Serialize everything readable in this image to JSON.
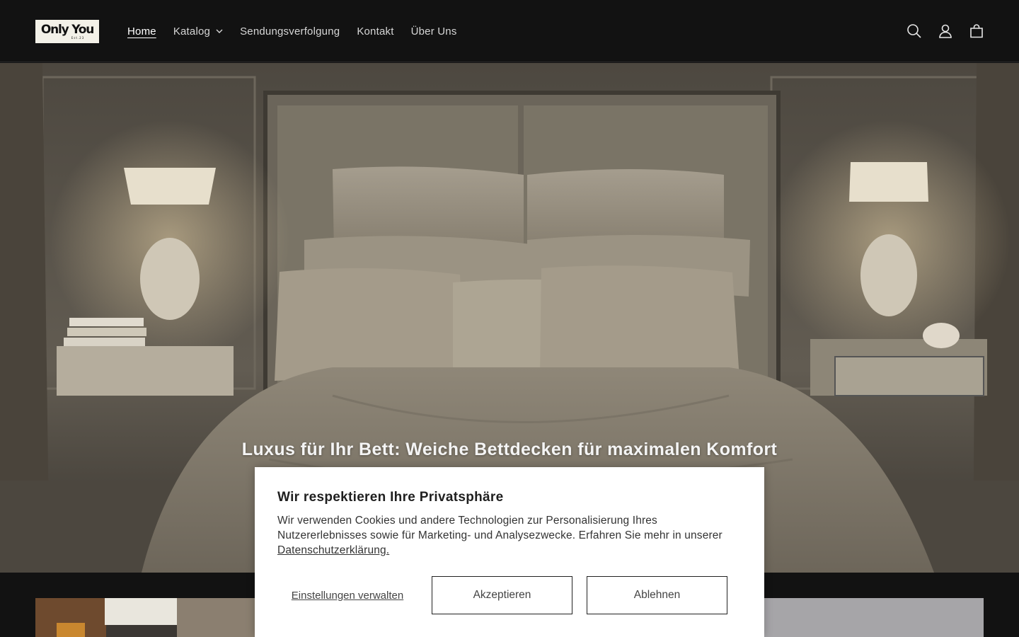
{
  "header": {
    "logo_text": "Only You",
    "logo_subtext": "Est.23",
    "nav": [
      {
        "label": "Home",
        "active": true
      },
      {
        "label": "Katalog",
        "has_dropdown": true
      },
      {
        "label": "Sendungsverfolgung"
      },
      {
        "label": "Kontakt"
      },
      {
        "label": "Über Uns"
      }
    ],
    "icons": [
      "search-icon",
      "account-icon",
      "cart-icon"
    ]
  },
  "hero": {
    "heading": "Luxus für Ihr Bett: Weiche Bettdecken für maximalen Komfort",
    "image": "bedroom-with-satin-bedding"
  },
  "cookie_banner": {
    "title": "Wir respektieren Ihre Privatsphäre",
    "text": "Wir verwenden Cookies und andere Technologien zur Personalisierung Ihres Nutzererlebnisses sowie für Marketing- und Analysezwecke. Erfahren Sie mehr in unserer ",
    "link_label": "Datenschutzerklärung.",
    "settings_label": "Einstellungen verwalten",
    "accept_label": "Akzeptieren",
    "decline_label": "Ablehnen"
  },
  "colors": {
    "header_bg": "#121212",
    "dialog_bg": "#ffffff",
    "text_dark": "#222222"
  }
}
